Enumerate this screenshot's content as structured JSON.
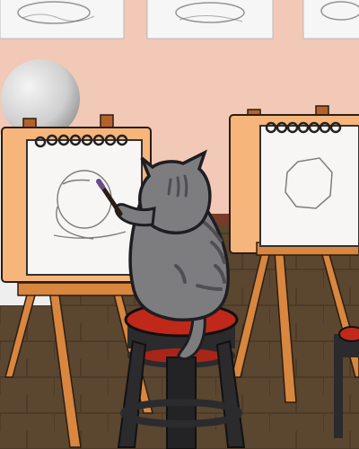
{
  "scene": {
    "subject": "cat-artist",
    "colors": {
      "wall": "#f2c8b6",
      "floor": "#5b4630",
      "easel_wood": "#d9863e",
      "board": "#f6b57a",
      "paper": "#f7f6f4",
      "stool_frame": "#2b2b2d",
      "stool_seat": "#c0281a",
      "cat_fur": "#7d7d80",
      "cat_outline": "#1e1e22"
    },
    "icons": [
      "sketch-frame-icon",
      "plaster-sphere-icon",
      "spiral-binding-icon",
      "paintbrush-icon"
    ]
  }
}
